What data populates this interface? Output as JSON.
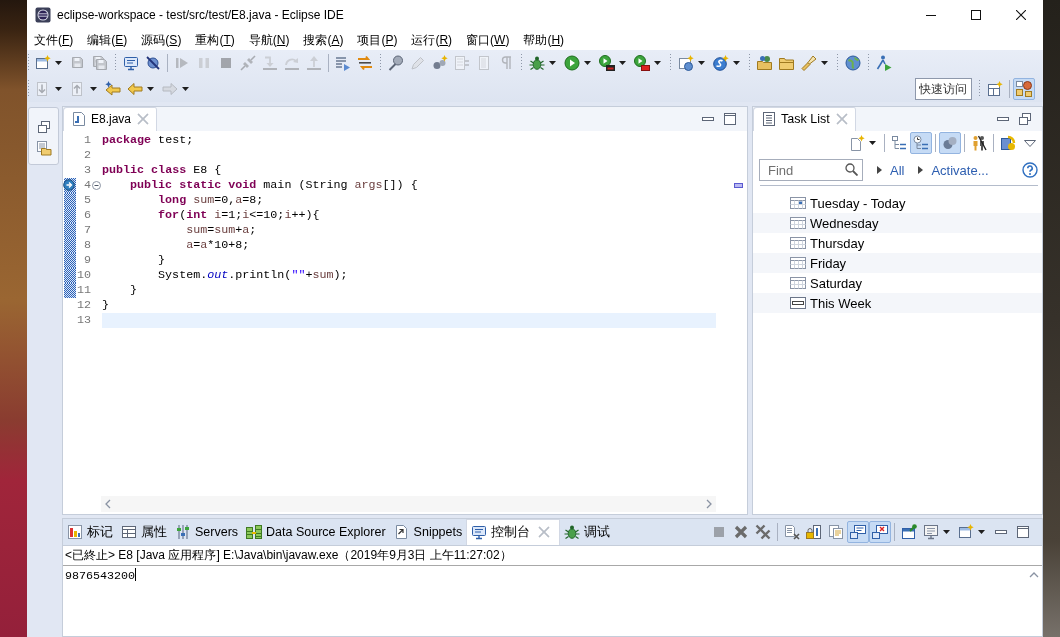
{
  "window": {
    "title": "eclipse-workspace - test/src/test/E8.java - Eclipse IDE"
  },
  "menu": [
    "文件(F)",
    "编辑(E)",
    "源码(S)",
    "重构(T)",
    "导航(N)",
    "搜索(A)",
    "项目(P)",
    "运行(R)",
    "窗口(W)",
    "帮助(H)"
  ],
  "toolbar_rows": [
    [
      {
        "kind": "grip"
      },
      {
        "kind": "new",
        "disabled": false
      },
      {
        "kind": "dropdown"
      },
      {
        "kind": "save",
        "disabled": true
      },
      {
        "kind": "save_all",
        "disabled": true
      },
      {
        "kind": "grip"
      },
      {
        "kind": "monitor",
        "disabled": false
      },
      {
        "kind": "skip_breakpoints",
        "disabled": false
      },
      {
        "kind": "line"
      },
      {
        "kind": "resume",
        "disabled": true
      },
      {
        "kind": "suspend",
        "disabled": true
      },
      {
        "kind": "terminate",
        "disabled": true
      },
      {
        "kind": "disconnect",
        "disabled": true
      },
      {
        "kind": "step_into",
        "disabled": true
      },
      {
        "kind": "step_over",
        "disabled": true
      },
      {
        "kind": "step_return",
        "disabled": true
      },
      {
        "kind": "line"
      },
      {
        "kind": "step_filters",
        "disabled": false
      },
      {
        "kind": "swap_arrows",
        "disabled": false
      },
      {
        "kind": "grip"
      },
      {
        "kind": "pin",
        "disabled": false
      },
      {
        "kind": "pen",
        "disabled": true
      },
      {
        "kind": "nodes",
        "disabled": false
      },
      {
        "kind": "document_arrows",
        "disabled": true
      },
      {
        "kind": "document",
        "disabled": true
      },
      {
        "kind": "pilcrow",
        "disabled": true
      },
      {
        "kind": "grip"
      },
      {
        "kind": "debug",
        "disabled": false
      },
      {
        "kind": "dropdown"
      },
      {
        "kind": "run",
        "disabled": false
      },
      {
        "kind": "dropdown"
      },
      {
        "kind": "coverage",
        "disabled": false
      },
      {
        "kind": "dropdown"
      },
      {
        "kind": "external_tools",
        "disabled": false
      },
      {
        "kind": "dropdown"
      },
      {
        "kind": "grip"
      },
      {
        "kind": "new_server",
        "disabled": false
      },
      {
        "kind": "dropdown"
      },
      {
        "kind": "circle_sparkle",
        "disabled": false
      },
      {
        "kind": "dropdown"
      },
      {
        "kind": "grip"
      },
      {
        "kind": "folder_dots",
        "disabled": false
      },
      {
        "kind": "folder",
        "disabled": false
      },
      {
        "kind": "flashlight",
        "disabled": false
      },
      {
        "kind": "dropdown"
      },
      {
        "kind": "grip"
      },
      {
        "kind": "globe",
        "disabled": false
      },
      {
        "kind": "grip"
      },
      {
        "kind": "figure_arrow",
        "disabled": false
      }
    ],
    [
      {
        "kind": "grip"
      },
      {
        "kind": "next_annotation",
        "disabled": true
      },
      {
        "kind": "dropdown"
      },
      {
        "kind": "previous_annotation",
        "disabled": true
      },
      {
        "kind": "dropdown"
      },
      {
        "kind": "last_edit",
        "disabled": false
      },
      {
        "kind": "back",
        "disabled": false
      },
      {
        "kind": "dropdown"
      },
      {
        "kind": "forward",
        "disabled": true
      },
      {
        "kind": "dropdown"
      }
    ]
  ],
  "quick_access": {
    "placeholder": "快速访问"
  },
  "perspectives": [
    {
      "kind": "open_perspective",
      "selected": false
    },
    {
      "kind": "java",
      "selected": true
    }
  ],
  "editor": {
    "tabs": [
      {
        "label": "E8.java",
        "kind": "java_file",
        "selected": true
      }
    ],
    "controls": [
      {
        "kind": "minimize"
      },
      {
        "kind": "maximize"
      }
    ],
    "lines": [
      {
        "number": "1",
        "current": false,
        "in_range": false,
        "marker": false,
        "tokens": [
          {
            "kind": "keyword",
            "text": "package"
          },
          {
            "kind": "plain",
            "text": " test;"
          }
        ]
      },
      {
        "number": "2",
        "current": false,
        "in_range": false,
        "marker": false
      },
      {
        "number": "3",
        "current": false,
        "in_range": false,
        "marker": false,
        "tokens": [
          {
            "kind": "keyword",
            "text": "public "
          },
          {
            "kind": "keyword",
            "text": "class"
          },
          {
            "kind": "plain",
            "text": " E8 {"
          }
        ],
        "children": [
          {
            "number": "4",
            "current": false,
            "in_range": true,
            "marker": true,
            "expanded": true,
            "tokens": [
              {
                "kind": "keyword",
                "text": "public "
              },
              {
                "kind": "keyword",
                "text": "static "
              },
              {
                "kind": "keyword",
                "text": "void"
              },
              {
                "kind": "plain",
                "text": " main (String "
              },
              {
                "kind": "local",
                "text": "args"
              },
              {
                "kind": "plain",
                "text": "[]) {"
              }
            ],
            "children": [
              {
                "number": "5",
                "current": false,
                "in_range": true,
                "marker": false,
                "tokens": [
                  {
                    "kind": "keyword",
                    "text": "long "
                  },
                  {
                    "kind": "local",
                    "text": "sum"
                  },
                  {
                    "kind": "plain",
                    "text": "=0,"
                  },
                  {
                    "kind": "local",
                    "text": "a"
                  },
                  {
                    "kind": "plain",
                    "text": "=8;"
                  }
                ]
              },
              {
                "number": "6",
                "current": false,
                "in_range": true,
                "marker": false,
                "tokens": [
                  {
                    "kind": "keyword",
                    "text": "for"
                  },
                  {
                    "kind": "plain",
                    "text": "("
                  },
                  {
                    "kind": "keyword",
                    "text": "int "
                  },
                  {
                    "kind": "local",
                    "text": "i"
                  },
                  {
                    "kind": "plain",
                    "text": "=1;"
                  },
                  {
                    "kind": "local",
                    "text": "i"
                  },
                  {
                    "kind": "plain",
                    "text": "<=10;"
                  },
                  {
                    "kind": "local",
                    "text": "i"
                  },
                  {
                    "kind": "plain",
                    "text": "++){"
                  }
                ],
                "children": [
                  {
                    "number": "7",
                    "current": false,
                    "in_range": true,
                    "marker": false,
                    "tokens": [
                      {
                        "kind": "local",
                        "text": "sum"
                      },
                      {
                        "kind": "plain",
                        "text": "="
                      },
                      {
                        "kind": "local",
                        "text": "sum"
                      },
                      {
                        "kind": "plain",
                        "text": "+"
                      },
                      {
                        "kind": "local",
                        "text": "a"
                      },
                      {
                        "kind": "plain",
                        "text": ";"
                      }
                    ]
                  },
                  {
                    "number": "8",
                    "current": false,
                    "in_range": true,
                    "marker": false,
                    "tokens": [
                      {
                        "kind": "local",
                        "text": "a"
                      },
                      {
                        "kind": "plain",
                        "text": "="
                      },
                      {
                        "kind": "local",
                        "text": "a"
                      },
                      {
                        "kind": "plain",
                        "text": "*10+8;"
                      }
                    ]
                  }
                ]
              },
              {
                "number": "9",
                "current": false,
                "in_range": true,
                "marker": false,
                "tokens": [
                  {
                    "kind": "plain",
                    "text": "}"
                  }
                ]
              },
              {
                "number": "10",
                "current": false,
                "in_range": true,
                "marker": false,
                "tokens": [
                  {
                    "kind": "plain",
                    "text": "System."
                  },
                  {
                    "kind": "field",
                    "text": "out"
                  },
                  {
                    "kind": "plain",
                    "text": ".println("
                  },
                  {
                    "kind": "string",
                    "text": "\"\""
                  },
                  {
                    "kind": "plain",
                    "text": "+"
                  },
                  {
                    "kind": "local",
                    "text": "sum"
                  },
                  {
                    "kind": "plain",
                    "text": ");"
                  }
                ]
              }
            ]
          },
          {
            "number": "11",
            "current": false,
            "in_range": true,
            "marker": false,
            "tokens": [
              {
                "kind": "plain",
                "text": "}"
              }
            ]
          }
        ]
      },
      {
        "number": "12",
        "current": false,
        "in_range": false,
        "marker": false,
        "tokens": [
          {
            "kind": "plain",
            "text": "}"
          }
        ]
      },
      {
        "number": "13",
        "current": true,
        "in_range": false,
        "marker": false
      }
    ]
  },
  "task_list": {
    "tabs": [
      {
        "label": "Task List",
        "kind": "task_list",
        "selected": true
      }
    ],
    "controls": [
      {
        "kind": "minimize"
      },
      {
        "kind": "restore"
      }
    ],
    "toolbar": [
      {
        "kind": "new_task",
        "on": false
      },
      {
        "kind": "dropdown"
      },
      {
        "kind": "line"
      },
      {
        "kind": "categorized",
        "on": false
      },
      {
        "kind": "scheduled",
        "on": true
      },
      {
        "kind": "line"
      },
      {
        "kind": "focus",
        "on": true
      },
      {
        "kind": "line"
      },
      {
        "kind": "hide_completed",
        "on": false
      },
      {
        "kind": "line"
      },
      {
        "kind": "sync",
        "on": false
      },
      {
        "kind": "view_menu",
        "on": false
      }
    ],
    "find": {
      "placeholder": "Find"
    },
    "links": [
      "All",
      "Activate..."
    ],
    "rows": [
      {
        "label": "Tuesday - Today",
        "kind": "today",
        "selected": false
      },
      {
        "label": "Wednesday",
        "kind": "day",
        "selected": false
      },
      {
        "label": "Thursday",
        "kind": "day",
        "selected": false
      },
      {
        "label": "Friday",
        "kind": "day",
        "selected": false
      },
      {
        "label": "Saturday",
        "kind": "day",
        "selected": false
      },
      {
        "label": "This Week",
        "kind": "week",
        "selected": false
      }
    ]
  },
  "bottom_panel": {
    "tabs": [
      {
        "label": "标记",
        "kind": "markers",
        "selected": false
      },
      {
        "label": "属性",
        "kind": "properties",
        "selected": false
      },
      {
        "label": "Servers",
        "kind": "servers",
        "selected": false
      },
      {
        "label": "Data Source Explorer",
        "kind": "data_source",
        "selected": false
      },
      {
        "label": "Snippets",
        "kind": "snippets",
        "selected": false
      },
      {
        "label": "控制台",
        "kind": "console",
        "selected": true
      },
      {
        "label": "调试",
        "kind": "debug",
        "selected": false
      }
    ],
    "toolbar": [
      {
        "kind": "terminate",
        "disabled": true,
        "on": false
      },
      {
        "kind": "remove_launch",
        "disabled": false,
        "on": false
      },
      {
        "kind": "remove_all",
        "disabled": false,
        "on": false
      },
      {
        "kind": "line"
      },
      {
        "kind": "clear",
        "disabled": false,
        "on": false
      },
      {
        "kind": "scroll_lock",
        "disabled": false,
        "on": false
      },
      {
        "kind": "word_wrap",
        "disabled": false,
        "on": false
      },
      {
        "kind": "show_stdout",
        "disabled": false,
        "on": true
      },
      {
        "kind": "show_stderr",
        "disabled": false,
        "on": true
      },
      {
        "kind": "line"
      },
      {
        "kind": "pin_console",
        "disabled": false,
        "on": false
      },
      {
        "kind": "display_console",
        "disabled": false,
        "on": false
      },
      {
        "kind": "dropdown"
      },
      {
        "kind": "open_console",
        "disabled": false,
        "on": false
      },
      {
        "kind": "dropdown"
      }
    ],
    "controls": [
      {
        "kind": "minimize"
      },
      {
        "kind": "maximize"
      }
    ],
    "console": {
      "header": "<已終止> E8 [Java 应用程序] E:\\Java\\bin\\javaw.exe（2019年9月3日 上午11:27:02）",
      "output": "9876543200"
    }
  }
}
